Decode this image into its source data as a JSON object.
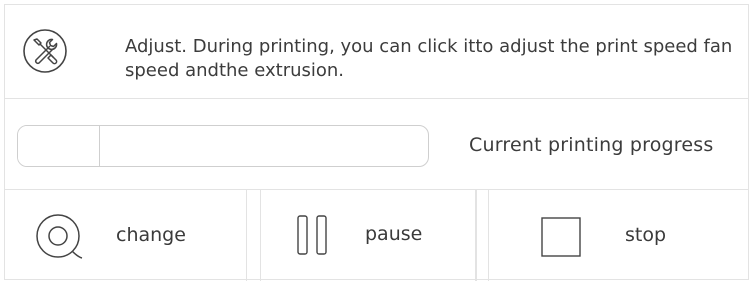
{
  "info": {
    "icon": "tools-icon",
    "text": "Adjust. During printing, you can click itto adjust the print speed fan speed andthe extrusion."
  },
  "progress": {
    "label": "Current printing progress",
    "value_fraction": 0.2
  },
  "actions": [
    {
      "label": "change",
      "icon": "filament-spool-icon"
    },
    {
      "label": "pause",
      "icon": "pause-icon"
    },
    {
      "label": "stop",
      "icon": "stop-icon"
    }
  ],
  "colors": {
    "border": "#e3e3e3",
    "icon_stroke": "#444444",
    "text": "#3a3a3a"
  }
}
